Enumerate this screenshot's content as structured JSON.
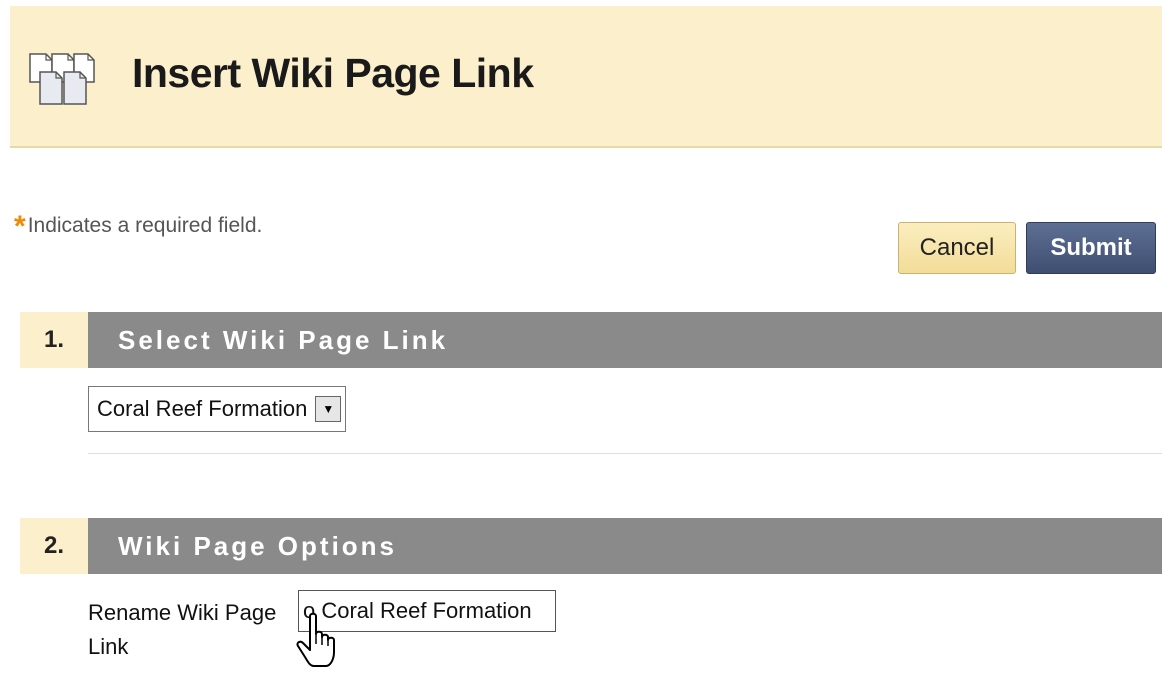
{
  "header": {
    "title": "Insert Wiki Page Link",
    "icon": "wiki-pages-icon"
  },
  "required_note": "Indicates a required field.",
  "buttons": {
    "cancel": "Cancel",
    "submit": "Submit"
  },
  "sections": [
    {
      "number": "1.",
      "title": "Select Wiki Page Link"
    },
    {
      "number": "2.",
      "title": "Wiki Page Options"
    }
  ],
  "select_page": {
    "value": "Coral Reef Formation"
  },
  "rename": {
    "label": "Rename Wiki Page Link",
    "value": "o Coral Reef Formation"
  },
  "colors": {
    "header_bg": "#fcefcb",
    "section_bar": "#8a8a8a",
    "submit_bg": "#4a5b7e",
    "required_star": "#f08a00"
  }
}
